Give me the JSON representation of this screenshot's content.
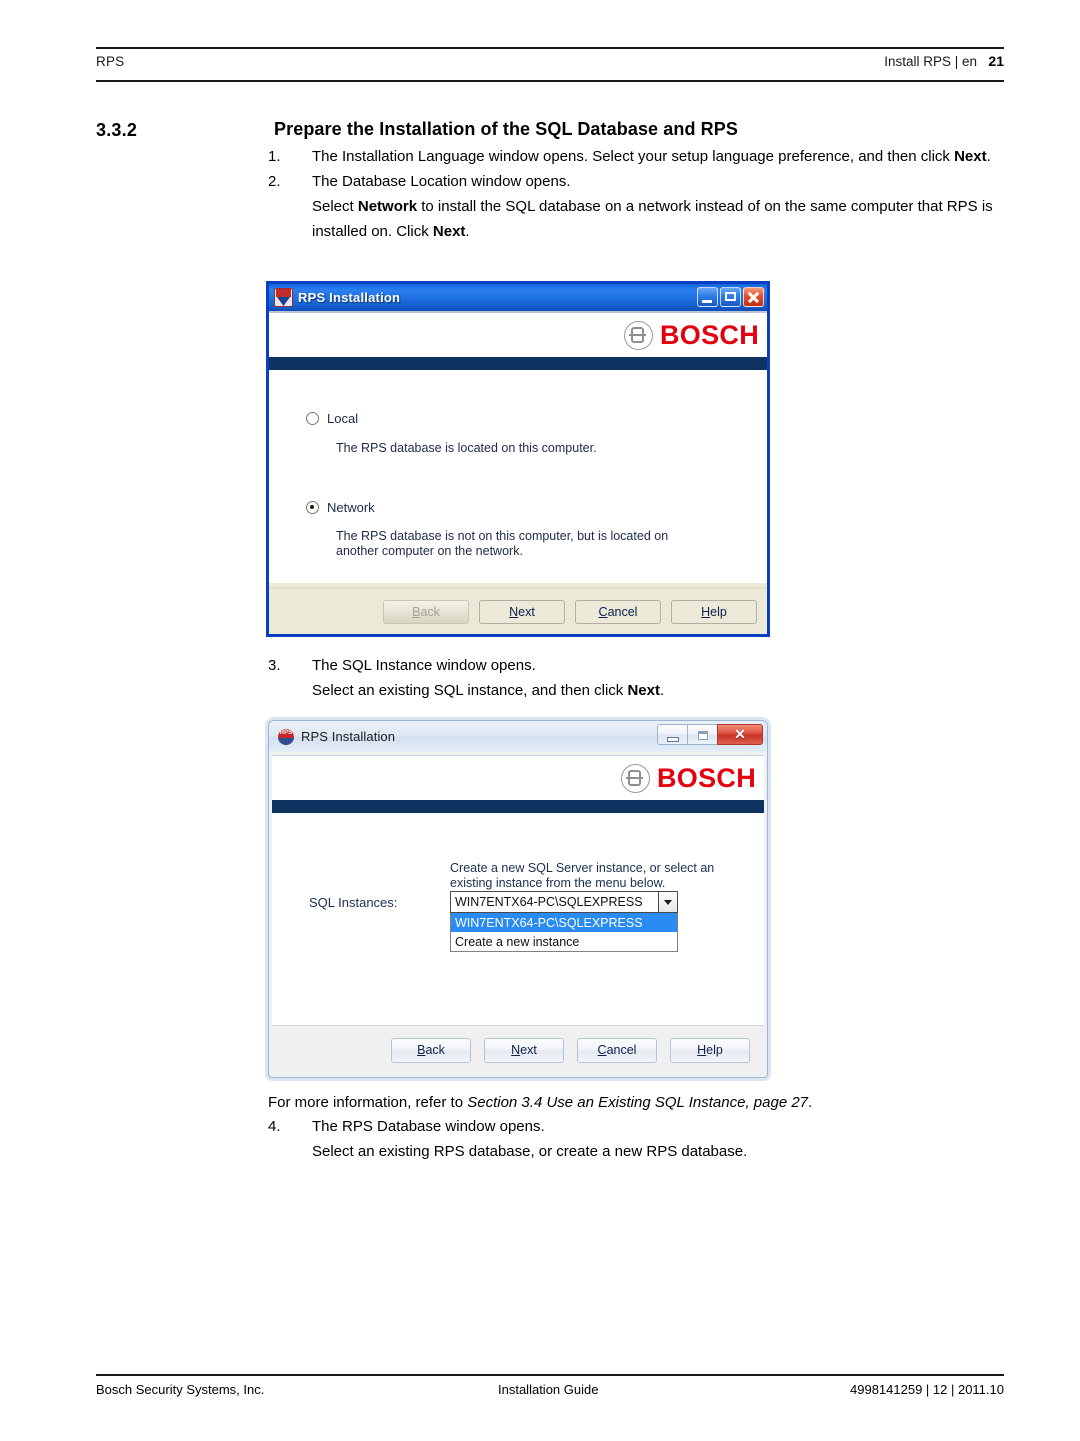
{
  "header": {
    "left": "RPS",
    "right": "Install RPS | en",
    "page_number": "21"
  },
  "section": {
    "number": "3.3.2",
    "title": "Prepare the Installation of the SQL Database and RPS"
  },
  "steps": {
    "s1_num": "1.",
    "s1_text_a": "The Installation Language window opens. Select your setup language preference, and then click ",
    "s1_bold": "Next",
    "s1_text_b": ".",
    "s2_num": "2.",
    "s2_line1": "The Database Location window opens.",
    "s2_line2_a": "Select ",
    "s2_line2_bold1": "Network",
    "s2_line2_b": " to install the SQL database on a network instead of on the same computer that RPS is installed on. Click ",
    "s2_line2_bold2": "Next",
    "s2_line2_c": ".",
    "s3_num": "3.",
    "s3_line1": "The SQL Instance window opens.",
    "s3_line2_a": "Select an existing SQL instance, and then click ",
    "s3_line2_bold": "Next",
    "s3_line2_b": ".",
    "note_a": "For more information, refer to ",
    "note_italic": "Section 3.4 Use an Existing SQL Instance, page 27",
    "note_b": ".",
    "s4_num": "4.",
    "s4_line1": "The RPS Database window opens.",
    "s4_line2": "Select an existing RPS database, or create a new RPS database."
  },
  "dialog1": {
    "title": "RPS Installation",
    "brand": "BOSCH",
    "radio_local_label": "Local",
    "radio_local_desc": "The RPS database is located on this computer.",
    "radio_local_checked": false,
    "radio_network_label": "Network",
    "radio_network_desc": "The RPS database is not on this computer, but is located on another computer on the network.",
    "radio_network_checked": true,
    "buttons": {
      "back": "Back",
      "back_disabled": true,
      "next": "Next",
      "cancel": "Cancel",
      "help": "Help"
    },
    "window_controls": {
      "minimize": "minimize",
      "maximize": "maximize",
      "close": "close"
    }
  },
  "dialog2": {
    "title": "RPS Installation",
    "brand": "BOSCH",
    "help_text": "Create a new SQL Server instance, or select an existing instance from the menu below.",
    "field_label": "SQL Instances:",
    "combo_value": "WIN7ENTX64-PC\\SQLEXPRESS",
    "combo_options": [
      "WIN7ENTX64-PC\\SQLEXPRESS",
      "Create a new instance"
    ],
    "combo_selected_index": 0,
    "buttons": {
      "back": "Back",
      "next": "Next",
      "cancel": "Cancel",
      "help": "Help"
    },
    "window_controls": {
      "minimize": "minimize",
      "maximize": "maximize",
      "close": "✕"
    }
  },
  "footer": {
    "left": "Bosch Security Systems, Inc.",
    "center": "Installation Guide",
    "right": "4998141259 | 12 | 2011.10"
  },
  "colors": {
    "bosch_red": "#e3000f",
    "navy_band": "#0f3360",
    "xp_titlebar": "#1d6fe0",
    "highlight_blue": "#2a8bf2"
  }
}
